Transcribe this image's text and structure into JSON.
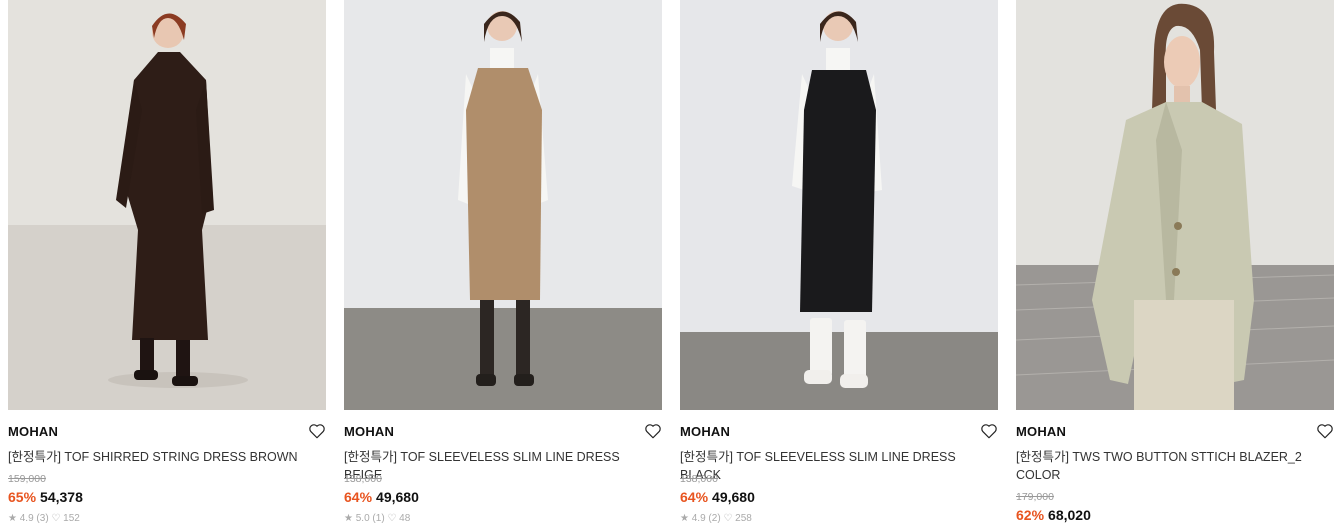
{
  "products": [
    {
      "brand": "MOHAN",
      "name": "[한정특가] TOF SHIRRED STRING DRESS BROWN",
      "original_price": "159,000",
      "discount": "65%",
      "price": "54,378",
      "meta": "★ 4.9 (3)   ♡ 152",
      "wishlist_icon": "heart-outline-icon",
      "colors": {
        "bg": "#e4e2dd",
        "floor": "#d7d3cd",
        "garment": "#2e1d17"
      }
    },
    {
      "brand": "MOHAN",
      "name": "[한정특가] TOF SLEEVELESS SLIM LINE DRESS BEIGE",
      "original_price": "138,000",
      "discount": "64%",
      "price": "49,680",
      "meta": "★ 5.0 (1)   ♡ 48",
      "wishlist_icon": "heart-outline-icon",
      "colors": {
        "bg": "#e7e8ea",
        "floor": "#8d8b86",
        "garment": "#b08e6b"
      }
    },
    {
      "brand": "MOHAN",
      "name": "[한정특가] TOF SLEEVELESS SLIM LINE DRESS BLACK",
      "original_price": "138,000",
      "discount": "64%",
      "price": "49,680",
      "meta": "★ 4.9 (2)   ♡ 258",
      "wishlist_icon": "heart-outline-icon",
      "colors": {
        "bg": "#e6e7ea",
        "floor": "#8a8884",
        "garment": "#1a1a1c"
      }
    },
    {
      "brand": "MOHAN",
      "name": "[한정특가] TWS TWO BUTTON STTICH BLAZER_2 COLOR",
      "original_price": "179,000",
      "discount": "62%",
      "price": "68,020",
      "wishlist_icon": "heart-outline-icon",
      "colors": {
        "bg": "#e3e2de",
        "floor": "#9a9794",
        "garment": "#c9c9b2"
      }
    }
  ]
}
